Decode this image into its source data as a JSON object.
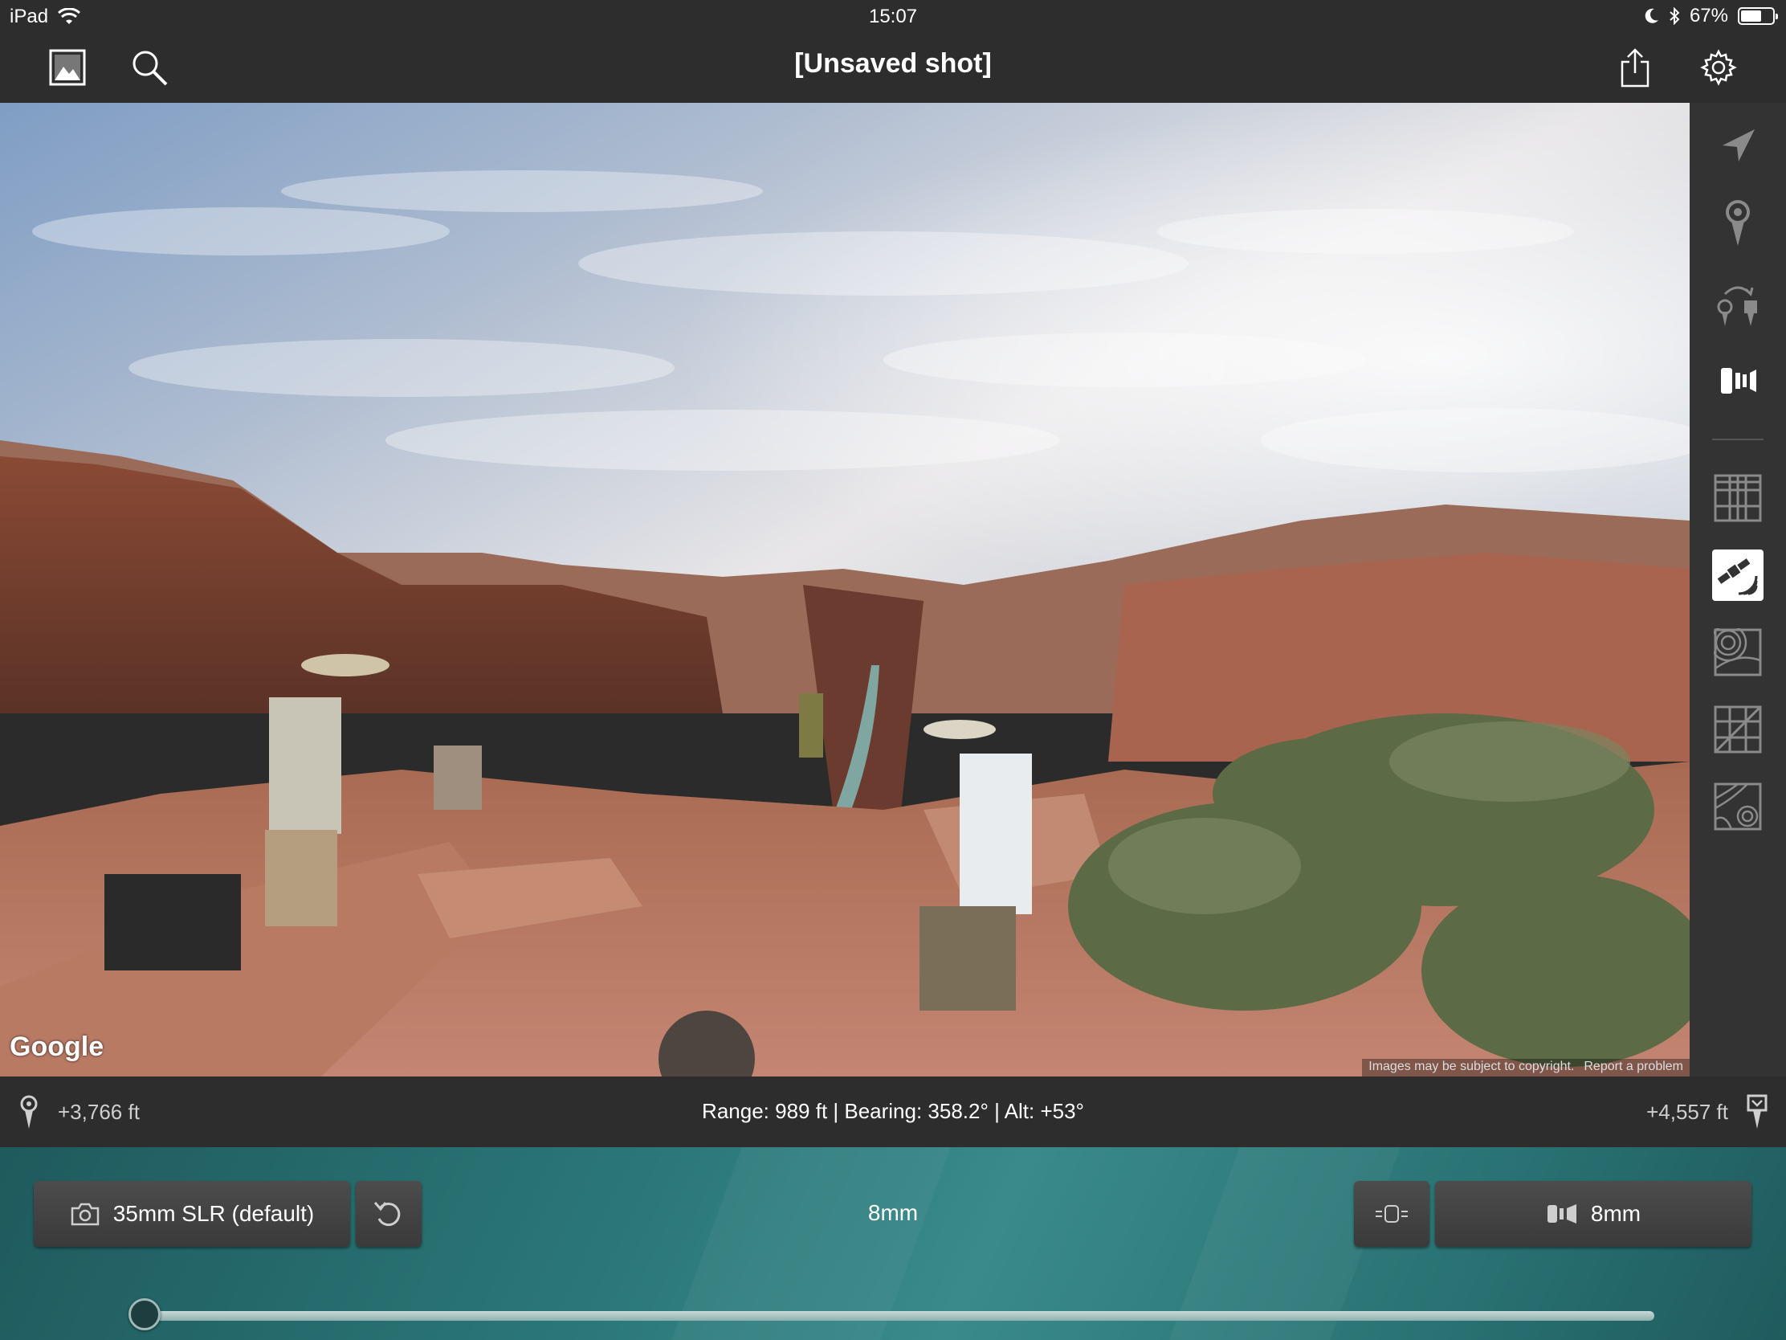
{
  "status_bar": {
    "device": "iPad",
    "time": "15:07",
    "battery_percent": "67%",
    "battery_level": 0.67
  },
  "nav": {
    "title": "[Unsaved shot]",
    "left_icons": [
      "photo-library-icon",
      "search-icon"
    ],
    "right_icons": [
      "share-icon",
      "gear-icon"
    ]
  },
  "viewer": {
    "logo": "Google",
    "copyright": "Images may be subject to copyright.",
    "report": "Report a problem"
  },
  "tools": [
    {
      "name": "location-arrow-icon",
      "active": false
    },
    {
      "name": "map-pin-icon",
      "active": false
    },
    {
      "name": "swap-pins-icon",
      "active": false
    },
    {
      "name": "lens-icon",
      "active": false
    },
    {
      "name": "street-map-icon",
      "active": false
    },
    {
      "name": "satellite-map-icon",
      "active": true
    },
    {
      "name": "terrain-map-icon",
      "active": false
    },
    {
      "name": "hybrid-map-icon",
      "active": false
    },
    {
      "name": "topo-map-icon",
      "active": false
    }
  ],
  "info_bar": {
    "left_elevation": "+3,766 ft",
    "readout": "Range: 989 ft | Bearing: 358.2° | Alt: +53°",
    "right_elevation": "+4,557 ft"
  },
  "camera_panel": {
    "camera_label": "35mm SLR (default)",
    "focal_length": "8mm",
    "lens_label": "8mm",
    "slider_value": 0.0
  },
  "colors": {
    "bar_bg": "#2d2d2d",
    "panel_teal": "#2b7778",
    "button_bg": "#444444"
  }
}
